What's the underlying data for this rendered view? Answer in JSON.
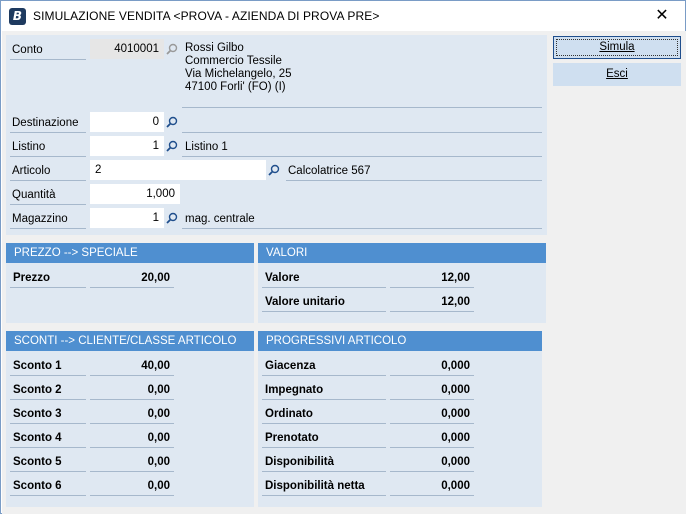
{
  "window": {
    "title": "SIMULAZIONE VENDITA <PROVA - AZIENDA DI PROVA PRE>",
    "app_icon_letter": "B",
    "close_glyph": "✕"
  },
  "form": {
    "conto": {
      "label": "Conto",
      "value": "4010001",
      "lines": [
        "Rossi Gilbo",
        "Commercio Tessile",
        "Via Michelangelo, 25",
        "47100 Forli' (FO) (I)"
      ]
    },
    "destinazione": {
      "label": "Destinazione",
      "value": "0",
      "desc": ""
    },
    "listino": {
      "label": "Listino",
      "value": "1",
      "desc": "Listino 1"
    },
    "articolo": {
      "label": "Articolo",
      "value": "2",
      "desc": "Calcolatrice 567"
    },
    "quantita": {
      "label": "Quantità",
      "value": "1,000"
    },
    "magazzino": {
      "label": "Magazzino",
      "value": "1",
      "desc": "mag. centrale"
    }
  },
  "buttons": {
    "simula": "Simula",
    "esci": "Esci"
  },
  "prezzo": {
    "header": "PREZZO --> SPECIALE",
    "rows": [
      {
        "label": "Prezzo",
        "value": "20,00"
      }
    ]
  },
  "valori": {
    "header": "VALORI",
    "rows": [
      {
        "label": "Valore",
        "value": "12,00"
      },
      {
        "label": "Valore unitario",
        "value": "12,00"
      }
    ]
  },
  "sconti": {
    "header": "SCONTI --> CLIENTE/CLASSE ARTICOLO",
    "rows": [
      {
        "label": "Sconto 1",
        "value": "40,00"
      },
      {
        "label": "Sconto 2",
        "value": "0,00"
      },
      {
        "label": "Sconto 3",
        "value": "0,00"
      },
      {
        "label": "Sconto 4",
        "value": "0,00"
      },
      {
        "label": "Sconto 5",
        "value": "0,00"
      },
      {
        "label": "Sconto 6",
        "value": "0,00"
      }
    ]
  },
  "progressivi": {
    "header": "PROGRESSIVI ARTICOLO",
    "rows": [
      {
        "label": "Giacenza",
        "value": "0,000"
      },
      {
        "label": "Impegnato",
        "value": "0,000"
      },
      {
        "label": "Ordinato",
        "value": "0,000"
      },
      {
        "label": "Prenotato",
        "value": "0,000"
      },
      {
        "label": "Disponibilità",
        "value": "0,000"
      },
      {
        "label": "Disponibilità netta",
        "value": "0,000"
      }
    ]
  },
  "colors": {
    "header_blue": "#4f8fd0",
    "panel_bg": "#dfe8f2",
    "button_bg": "#cfdff0"
  },
  "icons": {
    "lookup": "magnifier-icon",
    "close": "close-icon",
    "app": "app-logo-icon"
  }
}
